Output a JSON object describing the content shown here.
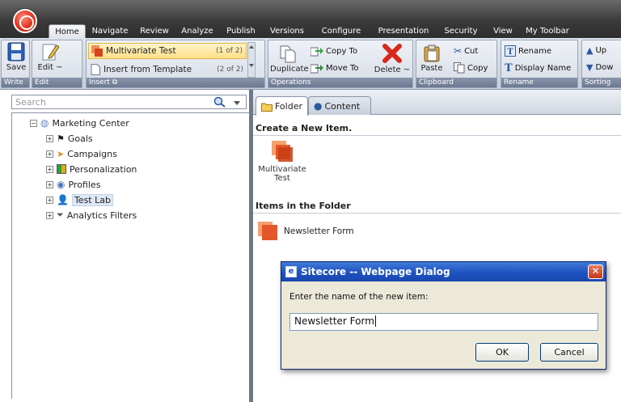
{
  "app": {
    "tabs": [
      "Home",
      "Navigate",
      "Review",
      "Analyze",
      "Publish",
      "Versions",
      "Configure",
      "Presentation",
      "Security",
      "View",
      "My Toolbar"
    ],
    "active_tab": "Home"
  },
  "ribbon": {
    "write": {
      "caption": "Write",
      "save_label": "Save"
    },
    "edit": {
      "caption": "Edit",
      "edit_label": "Edit ~"
    },
    "insert": {
      "caption": "Insert",
      "items": [
        {
          "label": "Multivariate Test",
          "count": "(1 of 2)"
        },
        {
          "label": "Insert from Template",
          "count": "(2 of 2)"
        }
      ]
    },
    "operations": {
      "caption": "Operations",
      "duplicate_label": "Duplicate",
      "copy_to_label": "Copy To",
      "move_to_label": "Move To",
      "delete_label": "Delete ~"
    },
    "clipboard": {
      "caption": "Clipboard",
      "paste_label": "Paste",
      "cut_label": "Cut",
      "copy_label": "Copy"
    },
    "rename": {
      "caption": "Rename",
      "rename_label": "Rename",
      "display_name_label": "Display Name"
    },
    "sorting": {
      "caption": "Sorting",
      "up_label": "Up",
      "down_label": "Dow"
    }
  },
  "left": {
    "search_placeholder": "Search",
    "tree": {
      "root": "Marketing Center",
      "children": [
        "Goals",
        "Campaigns",
        "Personalization",
        "Profiles",
        "Test Lab",
        "Analytics Filters"
      ]
    }
  },
  "right": {
    "tabs": {
      "folder": "Folder",
      "content": "Content"
    },
    "create_heading": "Create a New Item.",
    "create_item_label": "Multivariate Test",
    "items_heading": "Items in the Folder",
    "items": [
      "Newsletter Form"
    ]
  },
  "dialog": {
    "title": "Sitecore -- Webpage Dialog",
    "prompt": "Enter the name of the new item:",
    "value": "Newsletter Form",
    "ok_label": "OK",
    "cancel_label": "Cancel"
  }
}
